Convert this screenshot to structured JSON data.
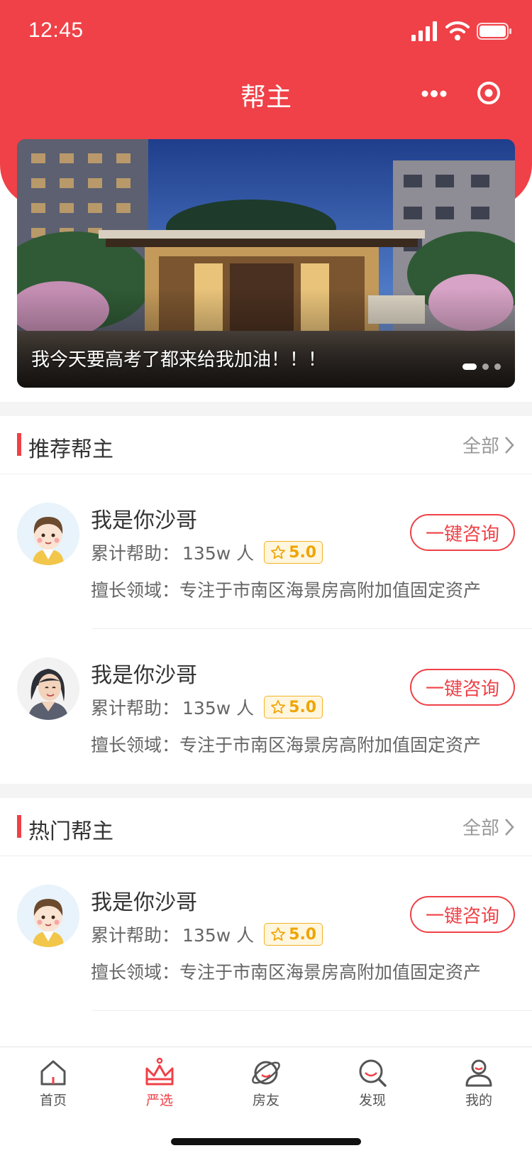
{
  "status_bar": {
    "time": "12:45"
  },
  "nav": {
    "title": "帮主"
  },
  "banner": {
    "caption": "我今天要高考了都来给我加油！！！",
    "slides": 3,
    "active_slide": 1
  },
  "recommended": {
    "title": "推荐帮主",
    "more_label": "全部",
    "items": [
      {
        "name": "我是你沙哥",
        "helped_label": "累计帮助：",
        "helped_value": "135w 人",
        "rating": "5.0",
        "field_label": "擅长领域：",
        "field_value": "专注于市南区海景房高附加值固定资产",
        "button": "一键咨询",
        "avatar": "boy-avatar"
      },
      {
        "name": "我是你沙哥",
        "helped_label": "累计帮助：",
        "helped_value": "135w 人",
        "rating": "5.0",
        "field_label": "擅长领域：",
        "field_value": "专注于市南区海景房高附加值固定资产",
        "button": "一键咨询",
        "avatar": "woman-avatar"
      }
    ]
  },
  "hot": {
    "title": "热门帮主",
    "more_label": "全部",
    "items": [
      {
        "name": "我是你沙哥",
        "helped_label": "累计帮助：",
        "helped_value": "135w 人",
        "rating": "5.0",
        "field_label": "擅长领域：",
        "field_value": "专注于市南区海景房高附加值固定资产",
        "button": "一键咨询",
        "avatar": "boy-avatar"
      }
    ]
  },
  "tabbar": {
    "items": [
      {
        "label": "首页",
        "icon": "home-icon",
        "active": false
      },
      {
        "label": "严选",
        "icon": "crown-icon",
        "active": true
      },
      {
        "label": "房友",
        "icon": "planet-icon",
        "active": false
      },
      {
        "label": "发现",
        "icon": "search-icon",
        "active": false
      },
      {
        "label": "我的",
        "icon": "profile-icon",
        "active": false
      }
    ]
  },
  "colors": {
    "brand": "#EF4147",
    "rating": "#F0A400",
    "muted": "#999999"
  }
}
